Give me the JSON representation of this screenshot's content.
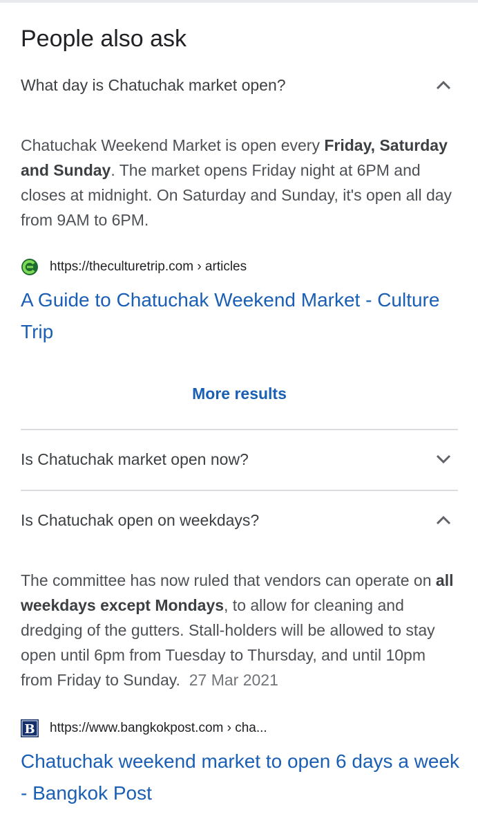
{
  "section_title": "People also ask",
  "questions": [
    {
      "question": "What day is Chatuchak market open?",
      "expanded": true,
      "answer_parts": [
        "Chatuchak Weekend Market is open every ",
        "Friday, Saturday and Sunday",
        ". The market opens Friday night at 6PM and closes at midnight. On Saturday and Sunday, it's open all day from 9AM to 6PM."
      ],
      "source_url": "https://theculturetrip.com › articles",
      "source_favicon": "culture-trip-favicon",
      "link_title": "A Guide to Chatuchak Weekend Market - Culture Trip"
    },
    {
      "question": "Is Chatuchak market open now?",
      "expanded": false
    },
    {
      "question": "Is Chatuchak open on weekdays?",
      "expanded": true,
      "answer_parts": [
        "The committee has now ruled that vendors can operate on ",
        "all weekdays except Mondays",
        ", to allow for cleaning and dredging of the gutters. Stall-holders will be allowed to stay open until 6pm from Tuesday to Thursday, and until 10pm from Friday to Sunday."
      ],
      "answer_date": "27 Mar 2021",
      "source_url": "https://www.bangkokpost.com › cha...",
      "source_favicon": "bangkok-post-favicon",
      "link_title": "Chatuchak weekend market to open 6 days a week - Bangkok Post"
    }
  ],
  "more_results_label": "More results",
  "colors": {
    "link": "#1a5fb4",
    "text": "#202124",
    "answer_text": "#4d5156",
    "divider": "#dadce0"
  }
}
